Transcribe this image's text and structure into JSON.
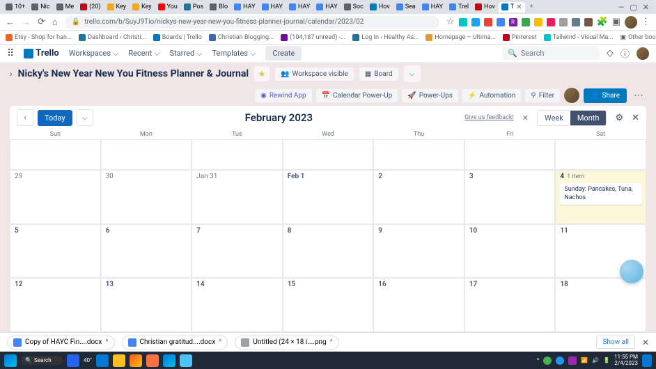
{
  "browser": {
    "tabs": [
      {
        "label": "10+",
        "color": "#5f6368"
      },
      {
        "label": "Nic",
        "color": "#5f6368"
      },
      {
        "label": "Me",
        "color": "#5f6368"
      },
      {
        "label": "(20)",
        "color": "#bd081c"
      },
      {
        "label": "Key",
        "color": "#f5a623"
      },
      {
        "label": "Key",
        "color": "#f5a623"
      },
      {
        "label": "You",
        "color": "#ff0000"
      },
      {
        "label": "Pos",
        "color": "#21759b"
      },
      {
        "label": "Blo",
        "color": "#5f6368"
      },
      {
        "label": "HAY",
        "color": "#4285f4"
      },
      {
        "label": "HAY",
        "color": "#4285f4"
      },
      {
        "label": "HAY",
        "color": "#4285f4"
      },
      {
        "label": "HAY",
        "color": "#4285f4"
      },
      {
        "label": "Soc",
        "color": "#5f6368"
      },
      {
        "label": "Hov",
        "color": "#0079bf"
      },
      {
        "label": "Sea",
        "color": "#4285f4"
      },
      {
        "label": "HAY",
        "color": "#4285f4"
      },
      {
        "label": "Trel",
        "color": "#4285f4"
      },
      {
        "label": "Hov",
        "color": "#bd081c"
      },
      {
        "label": "T",
        "color": "#0079bf",
        "active": true
      }
    ],
    "url": "trello.com/b/SuyJ9Tio/nickys-new-year-new-you-fitness-planner-journal/calendar/2023/02",
    "bookmarks": [
      {
        "label": "Etsy - Shop for han...",
        "color": "#f1641e"
      },
      {
        "label": "Dashboard ‹ Christi...",
        "color": "#21759b"
      },
      {
        "label": "Boards | Trello",
        "color": "#0079bf"
      },
      {
        "label": "Christian Blogging...",
        "color": "#4267b2"
      },
      {
        "label": "(104,187 unread) -...",
        "color": "#720e9e"
      },
      {
        "label": "Log In ‹ Healthy As...",
        "color": "#21759b"
      },
      {
        "label": "Homepage – Ultima...",
        "color": "#e09b3d"
      },
      {
        "label": "Pinterest",
        "color": "#bd081c"
      },
      {
        "label": "Tailwind - Visual Ma...",
        "color": "#00c4cc"
      }
    ],
    "other_bookmarks": "Other bookmarks"
  },
  "trello_header": {
    "logo": "Trello",
    "menus": [
      "Workspaces",
      "Recent",
      "Starred",
      "Templates"
    ],
    "create": "Create",
    "search_placeholder": "Search"
  },
  "board": {
    "title": "Nicky's New Year New You Fitness Planner & Journal",
    "workspace_btn": "Workspace visible",
    "board_btn": "Board",
    "powerups": {
      "rewind": "Rewind App",
      "calendar": "Calendar Power-Up",
      "powerups": "Power-Ups",
      "automation": "Automation",
      "filter": "Filter",
      "share": "Share"
    }
  },
  "calendar": {
    "today": "Today",
    "title": "February 2023",
    "feedback": "Give us feedback!",
    "week": "Week",
    "month": "Month",
    "days": [
      "Sun",
      "Mon",
      "Tue",
      "Wed",
      "Thu",
      "Fri",
      "Sat"
    ],
    "cells": [
      {
        "label": ""
      },
      {
        "label": ""
      },
      {
        "label": ""
      },
      {
        "label": ""
      },
      {
        "label": ""
      },
      {
        "label": ""
      },
      {
        "label": ""
      },
      {
        "label": "29"
      },
      {
        "label": "30"
      },
      {
        "label": "Jan 31"
      },
      {
        "label": "Feb 1",
        "bold": true
      },
      {
        "label": "2",
        "bold": true
      },
      {
        "label": "3",
        "bold": true
      },
      {
        "label": "4",
        "bold": true,
        "today": true,
        "badge": "1 item",
        "card": "Sunday: Pancakes, Tuna, Nachos"
      },
      {
        "label": "5",
        "bold": true
      },
      {
        "label": "6",
        "bold": true
      },
      {
        "label": "7",
        "bold": true
      },
      {
        "label": "8",
        "bold": true
      },
      {
        "label": "9",
        "bold": true
      },
      {
        "label": "10",
        "bold": true
      },
      {
        "label": "11",
        "bold": true
      },
      {
        "label": "12",
        "bold": true
      },
      {
        "label": "13",
        "bold": true
      },
      {
        "label": "14",
        "bold": true
      },
      {
        "label": "15",
        "bold": true
      },
      {
        "label": "16",
        "bold": true
      },
      {
        "label": "17",
        "bold": true
      },
      {
        "label": "18",
        "bold": true
      }
    ]
  },
  "downloads": {
    "items": [
      {
        "label": "Copy of HAYC Fin....docx",
        "type": "doc"
      },
      {
        "label": "Christian gratitud....docx",
        "type": "doc"
      },
      {
        "label": "Untitled (24 × 18 i....png",
        "type": "img"
      }
    ],
    "show_all": "Show all"
  },
  "taskbar": {
    "search": "Search",
    "weather": "40°",
    "time": "11:55 PM",
    "date": "2/4/2023"
  }
}
